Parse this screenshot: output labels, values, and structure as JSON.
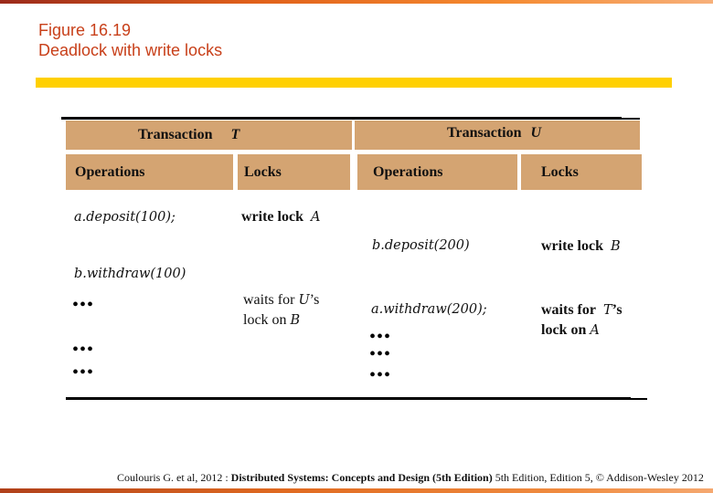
{
  "header": {
    "figure": "Figure 16.19",
    "title": "Deadlock with write locks"
  },
  "colors": {
    "title": "#c8401a",
    "accent_bar": "#ffd000",
    "table_header": "#d4a472"
  },
  "table": {
    "transaction_t": {
      "label": "Transaction",
      "name": "T"
    },
    "transaction_u": {
      "label": "Transaction",
      "name": "U"
    },
    "columns": {
      "t_ops": "Operations",
      "t_locks": "Locks",
      "u_ops": "Operations",
      "u_locks": "Locks"
    },
    "rows": [
      {
        "t_op": "a.deposit(100);",
        "t_lock": "write lock",
        "t_lock_var": "A"
      },
      {
        "u_op": "b.deposit(200)",
        "u_lock": "write lock",
        "u_lock_var": "B"
      },
      {
        "t_op": "b.withdraw(100)"
      },
      {
        "t_op": "•••",
        "t_lock_line1": "waits for",
        "t_lock_var": "U",
        "t_lock_suffix": "’s",
        "t_lock_line2": "lock on",
        "t_lock_var2": "B"
      },
      {
        "u_op": "a.withdraw(200);",
        "u_lock_line1": "waits for",
        "u_lock_var": "T",
        "u_lock_suffix": "’s",
        "u_lock_line2": "lock on",
        "u_lock_var2": "A"
      }
    ],
    "ellipsis": "•••"
  },
  "footer": {
    "prefix": "Coulouris G. et al, 2012 : ",
    "book": "Distributed Systems: Concepts and Design (5th Edition)",
    "suffix": " 5th Edition, Edition 5, © Addison-Wesley 2012"
  }
}
